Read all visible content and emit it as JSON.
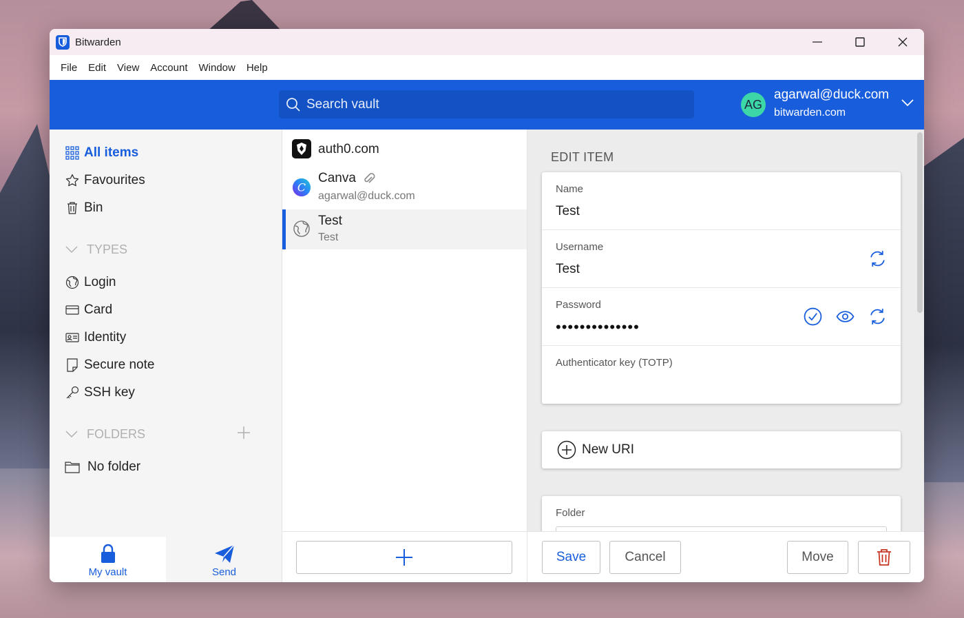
{
  "window": {
    "title": "Bitwarden"
  },
  "menu": [
    "File",
    "Edit",
    "View",
    "Account",
    "Window",
    "Help"
  ],
  "header": {
    "search_placeholder": "Search vault",
    "avatar_initials": "AG",
    "account_email": "agarwal@duck.com",
    "account_server": "bitwarden.com"
  },
  "sidebar": {
    "items": [
      {
        "label": "All items",
        "icon": "grid-icon"
      },
      {
        "label": "Favourites",
        "icon": "star-icon"
      },
      {
        "label": "Bin",
        "icon": "trash-icon"
      }
    ],
    "types_header": "TYPES",
    "types": [
      {
        "label": "Login",
        "icon": "globe-icon"
      },
      {
        "label": "Card",
        "icon": "credit-card-icon"
      },
      {
        "label": "Identity",
        "icon": "id-card-icon"
      },
      {
        "label": "Secure note",
        "icon": "note-icon"
      },
      {
        "label": "SSH key",
        "icon": "key-icon"
      }
    ],
    "folders_header": "FOLDERS",
    "folders": [
      {
        "label": "No folder",
        "icon": "folder-icon"
      }
    ],
    "tabs": [
      {
        "label": "My vault",
        "icon": "lock-icon"
      },
      {
        "label": "Send",
        "icon": "paper-plane-icon"
      }
    ]
  },
  "vault_list": [
    {
      "title": "auth0.com",
      "subtitle": "",
      "icon": "auth0-logo-icon"
    },
    {
      "title": "Canva",
      "subtitle": "agarwal@duck.com",
      "icon": "canva-logo-icon",
      "attachment": true
    },
    {
      "title": "Test",
      "subtitle": "Test",
      "icon": "globe-icon",
      "selected": true
    }
  ],
  "edit_item": {
    "heading": "EDIT ITEM",
    "name_label": "Name",
    "name_value": "Test",
    "username_label": "Username",
    "username_value": "Test",
    "password_label": "Password",
    "password_mask": "••••••••••••••",
    "totp_label": "Authenticator key (TOTP)",
    "new_uri_label": "New URI",
    "folder_label": "Folder"
  },
  "footer": {
    "save": "Save",
    "cancel": "Cancel",
    "move": "Move"
  },
  "colors": {
    "accent": "#175ddc",
    "danger": "#c83522",
    "avatar": "#3dd6a7"
  }
}
